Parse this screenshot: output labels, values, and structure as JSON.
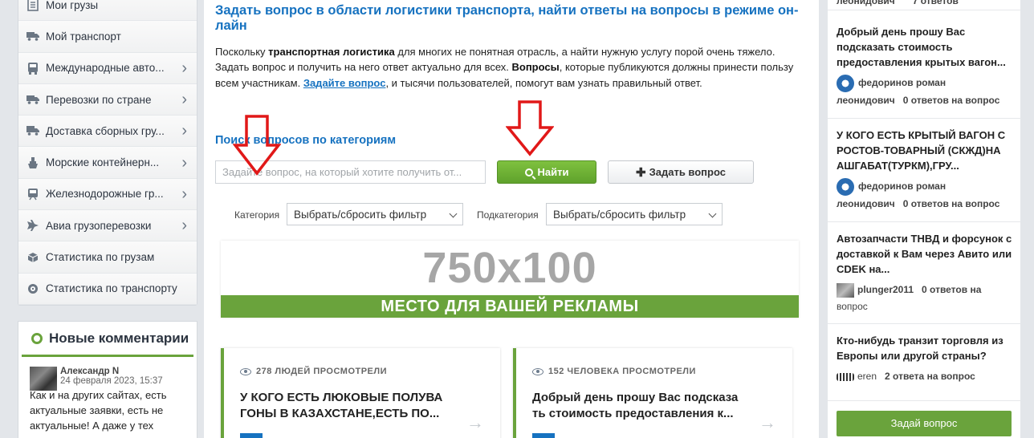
{
  "sidebar": {
    "items": [
      {
        "label": "Мои грузы",
        "icon": "document-icon",
        "chevron": false
      },
      {
        "label": "Мой транспорт",
        "icon": "truck-icon",
        "chevron": false
      },
      {
        "label": "Международные авто...",
        "icon": "bus-icon",
        "chevron": true
      },
      {
        "label": "Перевозки по стране",
        "icon": "truck-icon",
        "chevron": true
      },
      {
        "label": "Доставка сборных гру...",
        "icon": "delivery-truck-icon",
        "chevron": true
      },
      {
        "label": "Морские контейнерн...",
        "icon": "ship-icon",
        "chevron": true
      },
      {
        "label": "Железнодорожные гр...",
        "icon": "train-icon",
        "chevron": true
      },
      {
        "label": "Авиа грузоперевозки",
        "icon": "plane-icon",
        "chevron": true
      },
      {
        "label": "Статистика по грузам",
        "icon": "box-icon",
        "chevron": false
      },
      {
        "label": "Статистика по транспорту",
        "icon": "gauge-icon",
        "chevron": false
      }
    ]
  },
  "comments": {
    "title": "Новые комментарии",
    "item": {
      "author": "Александр N",
      "date": "24 февраля 2023, 15:37",
      "text": "Как и на других сайтах, есть актуальные заявки, есть не актуальные! А даже у тех"
    }
  },
  "main": {
    "heading": "Задать вопрос в области логистики транспорта, найти ответы на вопросы в режиме он-лайн",
    "intro": {
      "p1": "Поскольку ",
      "b1": "транспортная логистика",
      "p2": " для многих не понятная отрасль, а найти нужную услугу порой очень тяжело. Задать вопрос и получить на него ответ актуально для всех. ",
      "b2": "Вопросы",
      "p3": ", которые публикуются должны принести пользу всем участникам. ",
      "link": "Задайте вопрос",
      "p4": ", и тысячи пользователей, помогут вам узнать правильный ответ."
    },
    "search_title": "Поиск вопросов по категориям",
    "search_placeholder": "Задайте вопрос, на который хотите получить от...",
    "find_label": "Найти",
    "ask_label": "Задать вопрос",
    "category_label": "Категория",
    "category_value": "Выбрать/сбросить фильтр",
    "subcategory_label": "Подкатегория",
    "subcategory_value": "Выбрать/сбросить фильтр",
    "ad_size": "750x100",
    "ad_text": "МЕСТО ДЛЯ ВАШЕЙ РЕКЛАМЫ",
    "cards": [
      {
        "views": "278 ЛЮДЕЙ ПРОСМОТРЕЛИ",
        "title": "У КОГО ЕСТЬ ЛЮКОВЫЕ ПОЛУВА ГОНЫ В КАЗАХСТАНЕ,ЕСТЬ ПО..."
      },
      {
        "views": "152 ЧЕЛОВЕКА ПРОСМОТРЕЛИ",
        "title": "Добрый день прошу Вас подсказа ть стоимость предоставления к..."
      }
    ]
  },
  "right": {
    "top_meta": {
      "user": "леонидович",
      "count": "7 ответов"
    },
    "questions": [
      {
        "q": "Добрый день прошу Вас подсказать стоимость предоставления крытых вагон...",
        "user1": "федоринов роман",
        "user2": "леонидович",
        "count": "0 ответов на вопрос"
      },
      {
        "q": "У КОГО ЕСТЬ КРЫТЫЙ ВАГОН С РОСТОВ-ТОВАРНЫЙ (СКЖД)НА АШГАБАТ(ТУРКМ),ГРУ...",
        "user1": "федоринов роман",
        "user2": "леонидович",
        "count": "0 ответов на вопрос"
      },
      {
        "q": "Автозапчасти ТНВД и форсунок с доставкой к Вам через Авито или CDEK на...",
        "user1": "plunger2011",
        "count1": "0 ответов на",
        "user2": "вопрос"
      },
      {
        "q": "Кто-нибудь транзит торговля из Европы или другой страны?",
        "user1": "eren",
        "count": "2 ответа на вопрос"
      }
    ],
    "ask_button": "Задай вопрос"
  }
}
